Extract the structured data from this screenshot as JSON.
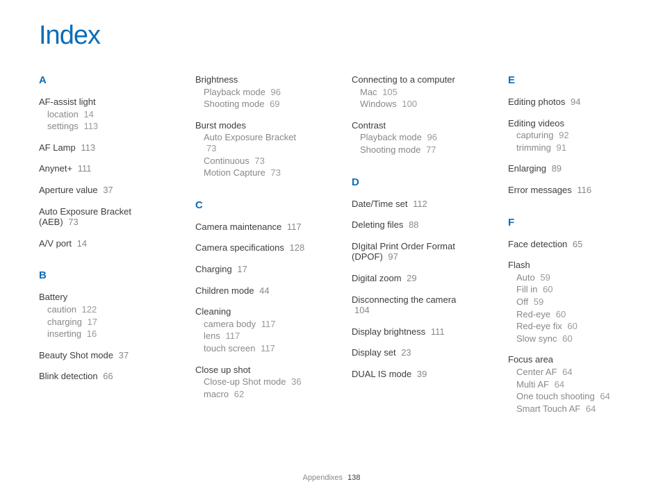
{
  "title": "Index",
  "footer": {
    "label": "Appendixes",
    "page": "138"
  },
  "cols": [
    [
      {
        "type": "letter",
        "text": "A"
      },
      {
        "type": "entry",
        "title": "AF-assist light",
        "subs": [
          {
            "label": "location",
            "page": "14"
          },
          {
            "label": "settings",
            "page": "113"
          }
        ]
      },
      {
        "type": "entry",
        "title": "AF Lamp",
        "page": "113"
      },
      {
        "type": "entry",
        "title": "Anynet+",
        "page": "111"
      },
      {
        "type": "entry",
        "title": "Aperture value",
        "page": "37"
      },
      {
        "type": "entry",
        "title": "Auto Exposure Bracket (AEB)",
        "page": "73"
      },
      {
        "type": "entry",
        "title": "A/V port",
        "page": "14"
      },
      {
        "type": "letter",
        "text": "B",
        "spaced": true
      },
      {
        "type": "entry",
        "title": "Battery",
        "subs": [
          {
            "label": "caution",
            "page": "122"
          },
          {
            "label": "charging",
            "page": "17"
          },
          {
            "label": "inserting",
            "page": "16"
          }
        ]
      },
      {
        "type": "entry",
        "title": "Beauty Shot mode",
        "page": "37"
      },
      {
        "type": "entry",
        "title": "Blink detection",
        "page": "66"
      }
    ],
    [
      {
        "type": "entry",
        "title": "Brightness",
        "subs": [
          {
            "label": "Playback mode",
            "page": "96"
          },
          {
            "label": "Shooting mode",
            "page": "69"
          }
        ]
      },
      {
        "type": "entry",
        "title": "Burst modes",
        "subs": [
          {
            "label": "Auto Exposure Bracket",
            "page": "73"
          },
          {
            "label": "Continuous",
            "page": "73"
          },
          {
            "label": "Motion Capture",
            "page": "73"
          }
        ]
      },
      {
        "type": "letter",
        "text": "C",
        "spaced": true
      },
      {
        "type": "entry",
        "title": "Camera maintenance",
        "page": "117"
      },
      {
        "type": "entry",
        "title": "Camera specifications",
        "page": "128"
      },
      {
        "type": "entry",
        "title": "Charging",
        "page": "17"
      },
      {
        "type": "entry",
        "title": "Children mode",
        "page": "44"
      },
      {
        "type": "entry",
        "title": "Cleaning",
        "subs": [
          {
            "label": "camera body",
            "page": "117"
          },
          {
            "label": "lens",
            "page": "117"
          },
          {
            "label": "touch screen",
            "page": "117"
          }
        ]
      },
      {
        "type": "entry",
        "title": "Close up shot",
        "subs": [
          {
            "label": "Close-up Shot mode",
            "page": "36"
          },
          {
            "label": "macro",
            "page": "62"
          }
        ]
      }
    ],
    [
      {
        "type": "entry",
        "title": "Connecting to a computer",
        "subs": [
          {
            "label": "Mac",
            "page": "105"
          },
          {
            "label": "Windows",
            "page": "100"
          }
        ]
      },
      {
        "type": "entry",
        "title": "Contrast",
        "subs": [
          {
            "label": "Playback mode",
            "page": "96"
          },
          {
            "label": "Shooting mode",
            "page": "77"
          }
        ]
      },
      {
        "type": "letter",
        "text": "D",
        "spaced": true
      },
      {
        "type": "entry",
        "title": "Date/Time set",
        "page": "112"
      },
      {
        "type": "entry",
        "title": "Deleting files",
        "page": "88"
      },
      {
        "type": "entry",
        "title": "DIgital Print Order Format (DPOF)",
        "page": "97"
      },
      {
        "type": "entry",
        "title": "Digital zoom",
        "page": "29"
      },
      {
        "type": "entry",
        "title": "Disconnecting the camera",
        "page": "104"
      },
      {
        "type": "entry",
        "title": "Display brightness",
        "page": "111"
      },
      {
        "type": "entry",
        "title": "Display set",
        "page": "23"
      },
      {
        "type": "entry",
        "title": "DUAL IS mode",
        "page": "39"
      }
    ],
    [
      {
        "type": "letter",
        "text": "E"
      },
      {
        "type": "entry",
        "title": "Editing photos",
        "page": "94"
      },
      {
        "type": "entry",
        "title": "Editing videos",
        "subs": [
          {
            "label": "capturing",
            "page": "92"
          },
          {
            "label": "trimming",
            "page": "91"
          }
        ]
      },
      {
        "type": "entry",
        "title": "Enlarging",
        "page": "89"
      },
      {
        "type": "entry",
        "title": "Error messages",
        "page": "116"
      },
      {
        "type": "letter",
        "text": "F",
        "spaced": true
      },
      {
        "type": "entry",
        "title": "Face detection",
        "page": "65"
      },
      {
        "type": "entry",
        "title": "Flash",
        "subs": [
          {
            "label": "Auto",
            "page": "59"
          },
          {
            "label": "Fill in",
            "page": "60"
          },
          {
            "label": "Off",
            "page": "59"
          },
          {
            "label": "Red-eye",
            "page": "60"
          },
          {
            "label": "Red-eye fix",
            "page": "60"
          },
          {
            "label": "Slow sync",
            "page": "60"
          }
        ]
      },
      {
        "type": "entry",
        "title": "Focus area",
        "subs": [
          {
            "label": "Center AF",
            "page": "64"
          },
          {
            "label": "Multi AF",
            "page": "64"
          },
          {
            "label": "One touch shooting",
            "page": "64"
          },
          {
            "label": "Smart Touch AF",
            "page": "64"
          }
        ]
      }
    ]
  ]
}
